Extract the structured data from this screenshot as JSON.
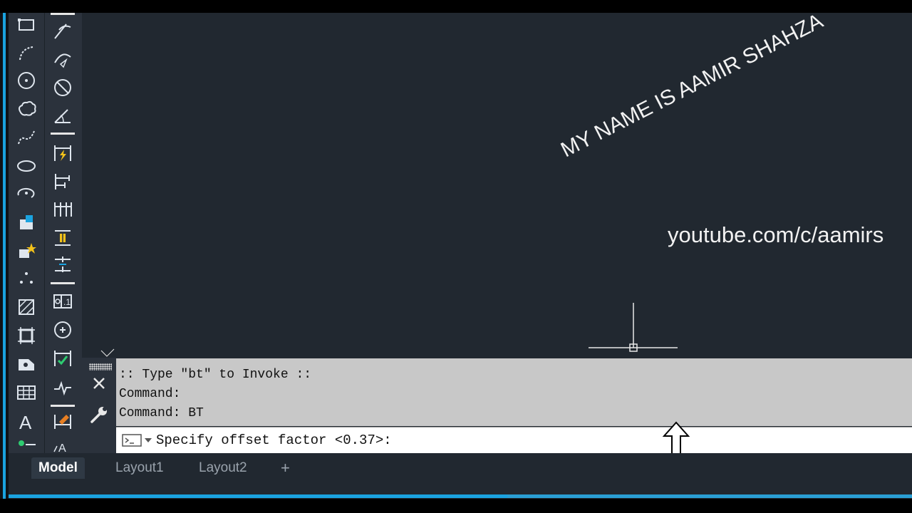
{
  "canvas": {
    "rotated_text": "MY NAME IS AAMIR SHAHZA",
    "url_text": "youtube.com/c/aamirs"
  },
  "command_line": {
    "history": [
      ":: Type \"bt\" to Invoke ::",
      "Command:",
      "Command: BT"
    ],
    "prompt": "Specify offset factor <0.37>:"
  },
  "layout_tabs": {
    "model": "Model",
    "layout1": "Layout1",
    "layout2": "Layout2",
    "add": "+"
  },
  "toolbar_left": [
    "rectangle-icon",
    "arc-icon",
    "circle-icon",
    "revision-cloud-icon",
    "spline-icon",
    "ellipse-icon",
    "ellipse-arc-icon",
    "insert-block-icon",
    "make-block-icon",
    "point-icon",
    "hatch-icon",
    "region-icon",
    "wipeout-icon",
    "table-icon",
    "multiline-text-icon",
    "add-selected-icon"
  ],
  "toolbar_right": [
    "dim-arc-icon",
    "dim-arc-length-icon",
    "dim-diameter-icon",
    "dim-angular-icon",
    "quick-dim-icon",
    "dim-baseline-icon",
    "dim-continue-icon",
    "dim-space-icon",
    "dim-break-icon",
    "tolerance-icon",
    "center-mark-icon",
    "inspect-icon",
    "jogged-linear-icon",
    "dim-update-icon",
    "dim-text-edit-icon"
  ],
  "colors": {
    "background": "#212830",
    "panel": "#2b323c",
    "accent": "#1aa3e0"
  }
}
